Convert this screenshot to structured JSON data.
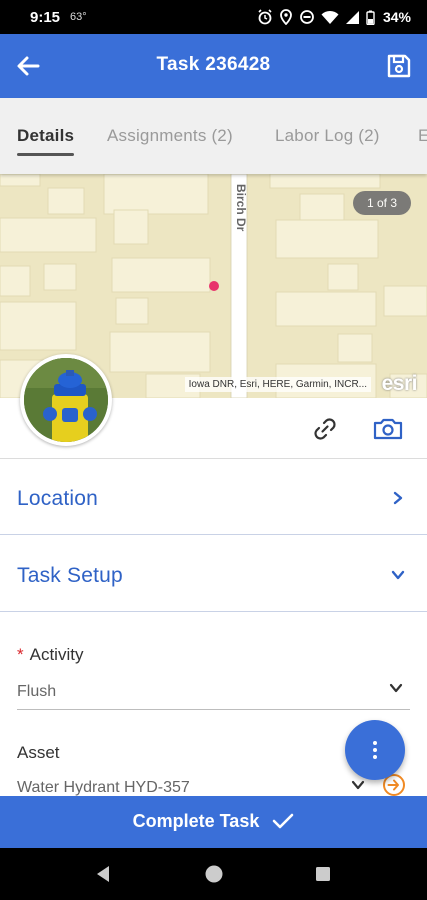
{
  "status_bar": {
    "time": "9:15",
    "temperature": "63°",
    "battery": "34%",
    "icons": [
      "alarm-icon",
      "location-icon",
      "dnd-icon",
      "wifi-icon",
      "signal-icon",
      "battery-icon"
    ]
  },
  "app_bar": {
    "title": "Task 236428",
    "back_icon": "arrow-left-icon",
    "save_icon": "save-icon"
  },
  "tabs": [
    {
      "label": "Details",
      "active": true
    },
    {
      "label": "Assignments (2)",
      "active": false
    },
    {
      "label": "Labor Log (2)",
      "active": false
    },
    {
      "label": "E",
      "active": false
    }
  ],
  "map": {
    "pager": "1 of 3",
    "street_label": "Birch Dr",
    "attribution": "Iowa DNR, Esri, HERE, Garmin, INCR...",
    "logo": "esri"
  },
  "sections": {
    "location": {
      "label": "Location",
      "expanded": false
    },
    "task_setup": {
      "label": "Task Setup",
      "expanded": true
    }
  },
  "fields": {
    "activity": {
      "label": "Activity",
      "required": true,
      "value": "Flush"
    },
    "asset": {
      "label": "Asset",
      "required": false,
      "value": "Water Hydrant HYD-357"
    }
  },
  "footer": {
    "complete_label": "Complete Task"
  },
  "colors": {
    "primary": "#3a6fd8",
    "section_text": "#2f62c6",
    "required": "#d9262b",
    "goto_accent": "#f08a24",
    "map_marker": "#e8336b"
  }
}
